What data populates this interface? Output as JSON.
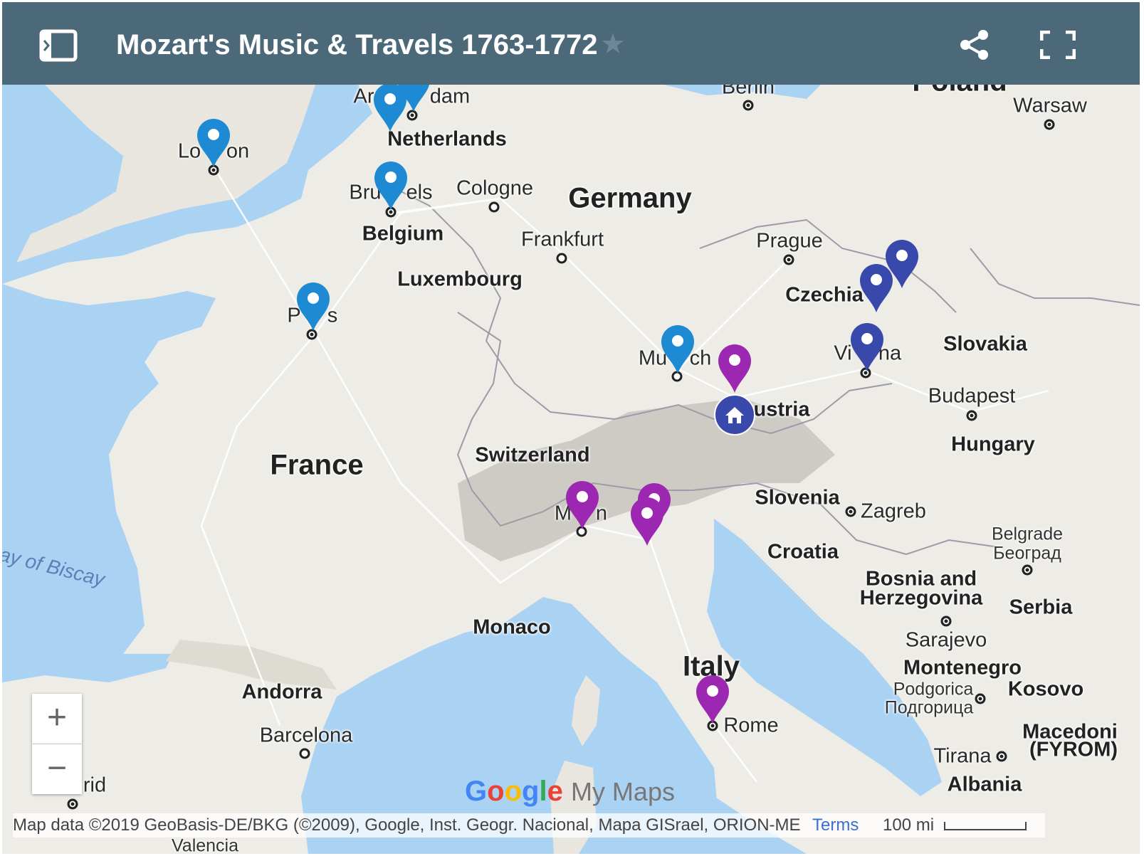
{
  "header": {
    "title": "Mozart's Music & Travels 1763-1772",
    "star_icon": "star-outline-icon",
    "share_icon": "share-icon",
    "fullscreen_icon": "fullscreen-icon",
    "sidebar_icon": "sidebar-toggle-icon"
  },
  "colors": {
    "header_bg": "#4b6979",
    "pin_blue": "#1e8ad3",
    "pin_navy": "#3949ab",
    "pin_purple": "#9c27b0",
    "water": "#aad2f3",
    "land": "#eeece6"
  },
  "map": {
    "labels": {
      "warsaw": "Warsaw",
      "berlin": "Berlin",
      "poland": "Poland",
      "amsterdam_a": "Ar",
      "amsterdam_b": "dam",
      "netherlands": "Netherlands",
      "london_a": "Lo",
      "london_b": "on",
      "brussels_a": "Bru",
      "brussels_b": "els",
      "cologne": "Cologne",
      "germany": "Germany",
      "belgium": "Belgium",
      "frankfurt": "Frankfurt",
      "prague": "Prague",
      "luxembourg": "Luxembourg",
      "czechia": "Czechia",
      "paris_a": "P",
      "paris_b": "s",
      "munich_a": "Mu",
      "munich_b": "ch",
      "vienna_a": "Vi",
      "vienna_b": "na",
      "slovakia": "Slovakia",
      "austria": "ustria",
      "budapest": "Budapest",
      "hungary": "Hungary",
      "france": "France",
      "switzerland": "Switzerland",
      "milan_a": "M",
      "milan_b": "n",
      "slovenia": "Slovenia",
      "zagreb": "Zagreb",
      "croatia": "Croatia",
      "belgrade": "Belgrade",
      "belgrade_cyr": "Београд",
      "bay_of_biscay": "ay of Biscay",
      "bosnia1": "Bosnia and",
      "bosnia2": "Herzegovina",
      "serbia": "Serbia",
      "sarajevo": "Sarajevo",
      "monaco": "Monaco",
      "montenegro": "Montenegro",
      "italy": "Italy",
      "podgorica": "Podgorica",
      "podgorica_cyr": "Подгорица",
      "kosovo": "Kosovo",
      "andorra": "Andorra",
      "barcelona": "Barcelona",
      "rome": "Rome",
      "macedonia1": "Macedoni",
      "macedonia2": "(FYROM)",
      "tirana": "Tirana",
      "albania": "Albania",
      "madrid": "rid",
      "valencia": "Valencia"
    },
    "pins": [
      {
        "place": "London",
        "color": "blue",
        "icon": "map-pin-icon"
      },
      {
        "place": "Amsterdam",
        "color": "blue",
        "icon": "map-pin-icon"
      },
      {
        "place": "The Hague",
        "color": "blue",
        "icon": "map-pin-icon"
      },
      {
        "place": "Brussels",
        "color": "blue",
        "icon": "map-pin-icon"
      },
      {
        "place": "Paris",
        "color": "blue",
        "icon": "map-pin-icon"
      },
      {
        "place": "Munich",
        "color": "blue",
        "icon": "map-pin-icon"
      },
      {
        "place": "Salzburg",
        "color": "purple",
        "icon": "map-pin-icon"
      },
      {
        "place": "Salzburg home",
        "color": "navy",
        "icon": "home-icon"
      },
      {
        "place": "Olomouc",
        "color": "navy",
        "icon": "map-pin-icon"
      },
      {
        "place": "Brno",
        "color": "navy",
        "icon": "map-pin-icon"
      },
      {
        "place": "Vienna",
        "color": "navy",
        "icon": "map-pin-icon"
      },
      {
        "place": "Milan",
        "color": "purple",
        "icon": "map-pin-icon"
      },
      {
        "place": "Verona",
        "color": "purple",
        "icon": "map-pin-icon"
      },
      {
        "place": "Bologna",
        "color": "purple",
        "icon": "map-pin-icon"
      },
      {
        "place": "Rome",
        "color": "purple",
        "icon": "map-pin-icon"
      }
    ]
  },
  "controls": {
    "zoom_in": "+",
    "zoom_out": "−"
  },
  "branding": {
    "google": "Google",
    "my_maps": "My Maps"
  },
  "footer": {
    "attribution": "Map data ©2019 GeoBasis-DE/BKG (©2009), Google, Inst. Geogr. Nacional, Mapa GISrael, ORION-ME",
    "terms": "Terms",
    "scale": "100 mi"
  }
}
